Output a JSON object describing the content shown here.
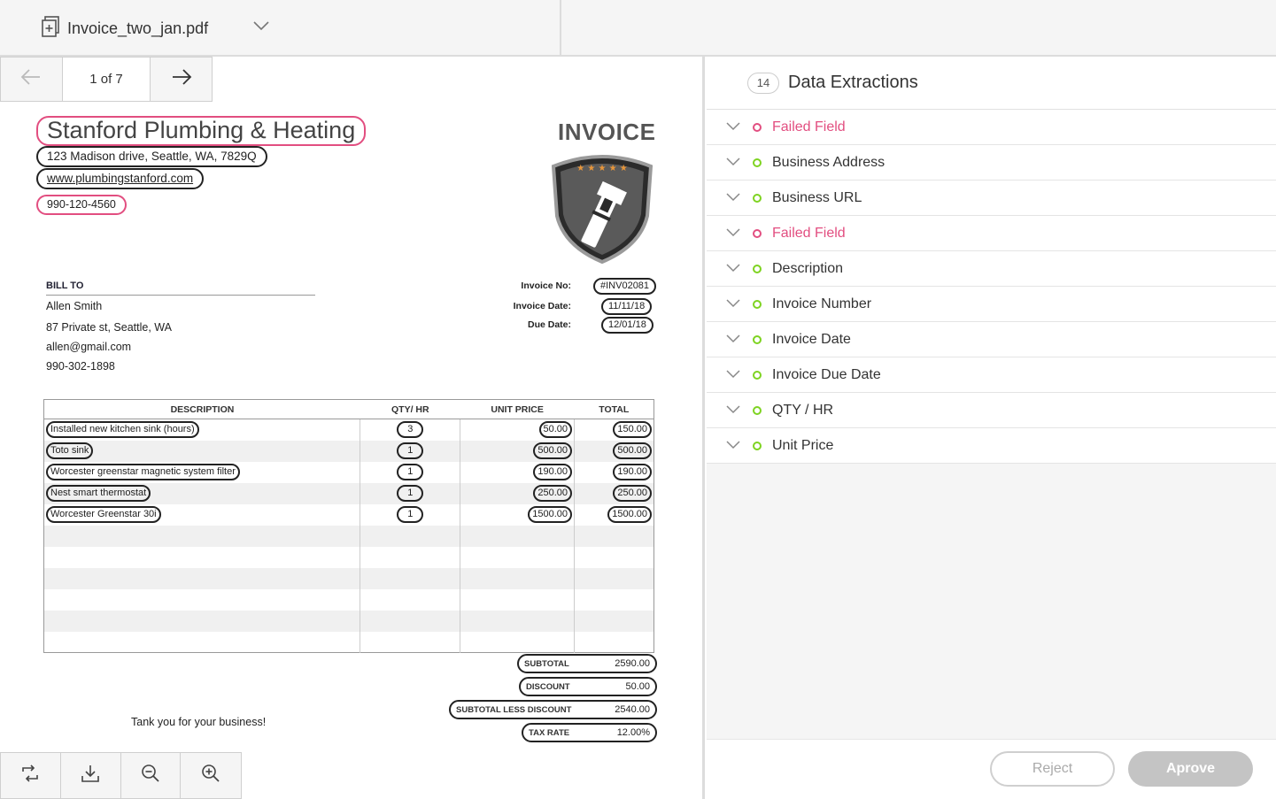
{
  "file": {
    "name": "Invoice_two_jan.pdf"
  },
  "pager": {
    "info": "1 of 7"
  },
  "invoice": {
    "business_name": "Stanford Plumbing & Heating",
    "business_address": "123 Madison drive, Seattle, WA, 7829Q",
    "business_url": "www.plumbingstanford.com",
    "business_phone": "990-120-4560",
    "title": "INVOICE",
    "bill_to_heading": "BILL TO",
    "bill_to": [
      "Allen Smith",
      "87 Private st, Seattle, WA",
      "allen@gmail.com",
      "990-302-1898"
    ],
    "meta": [
      {
        "label": "Invoice No:",
        "value": "#INV02081"
      },
      {
        "label": "Invoice Date:",
        "value": "11/11/18"
      },
      {
        "label": "Due Date:",
        "value": "12/01/18"
      }
    ],
    "columns": [
      "DESCRIPTION",
      "QTY/ HR",
      "UNIT PRICE",
      "TOTAL"
    ],
    "items": [
      {
        "description": "Installed new kitchen sink (hours)",
        "qty": "3",
        "unit_price": "50.00",
        "total": "150.00"
      },
      {
        "description": "Toto sink",
        "qty": "1",
        "unit_price": "500.00",
        "total": "500.00"
      },
      {
        "description": "Worcester greenstar magnetic system filter",
        "qty": "1",
        "unit_price": "190.00",
        "total": "190.00"
      },
      {
        "description": "Nest smart thermostat",
        "qty": "1",
        "unit_price": "250.00",
        "total": "250.00"
      },
      {
        "description": "Worcester Greenstar 30i",
        "qty": "1",
        "unit_price": "1500.00",
        "total": "1500.00"
      }
    ],
    "totals": [
      {
        "label": "SUBTOTAL",
        "value": "2590.00"
      },
      {
        "label": "DISCOUNT",
        "value": "50.00"
      },
      {
        "label": "SUBTOTAL LESS DISCOUNT",
        "value": "2540.00"
      },
      {
        "label": "TAX RATE",
        "value": "12.00%"
      }
    ],
    "thanks": "Tank you for your business!"
  },
  "extractions": {
    "count": "14",
    "title": "Data Extractions",
    "items": [
      {
        "label": "Failed Field",
        "status": "failed"
      },
      {
        "label": "Business Address",
        "status": "ok"
      },
      {
        "label": "Business URL",
        "status": "ok"
      },
      {
        "label": "Failed Field",
        "status": "failed"
      },
      {
        "label": "Description",
        "status": "ok"
      },
      {
        "label": "Invoice Number",
        "status": "ok"
      },
      {
        "label": "Invoice Date",
        "status": "ok"
      },
      {
        "label": "Invoice Due Date",
        "status": "ok"
      },
      {
        "label": "QTY / HR",
        "status": "ok"
      },
      {
        "label": "Unit Price",
        "status": "ok"
      }
    ]
  },
  "actions": {
    "reject_label": "Reject",
    "approve_label": "Aprove"
  },
  "colors": {
    "failed": "#e24e80",
    "ok": "#7ed321",
    "approve_bg": "#c4c4c4"
  }
}
